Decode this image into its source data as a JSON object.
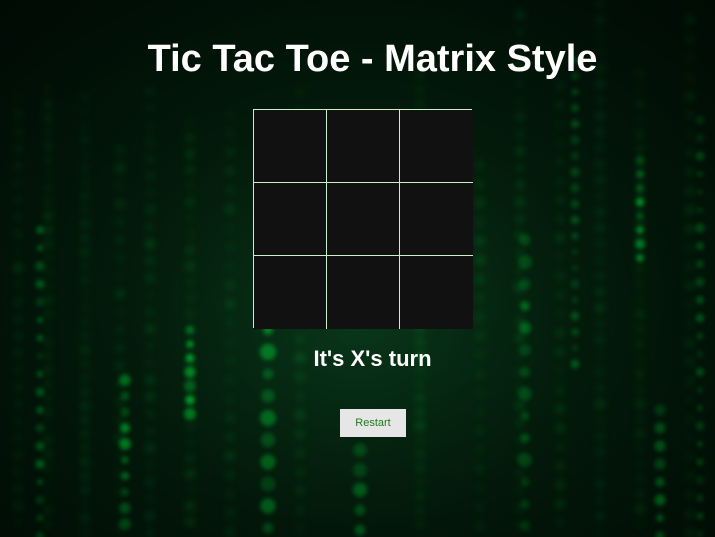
{
  "game": {
    "title": "Tic Tac Toe - Matrix Style",
    "status": "It's X's turn",
    "restart_label": "Restart",
    "board": [
      "",
      "",
      "",
      "",
      "",
      "",
      "",
      "",
      ""
    ],
    "current_player": "X"
  },
  "colors": {
    "background": "#03200d",
    "glyph_green": "#00ff41",
    "cell_fill": "#111111",
    "grid_line": "#c9f0c9",
    "button_bg": "#e6e6e6",
    "button_text": "#1f7a1f"
  }
}
